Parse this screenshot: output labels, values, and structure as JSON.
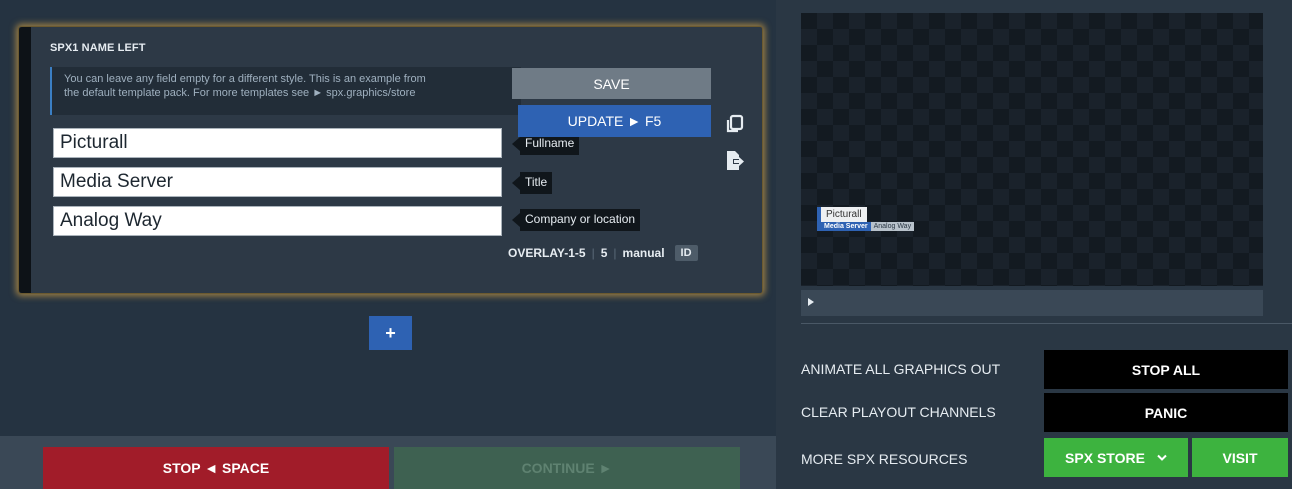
{
  "card": {
    "title": "SPX1 NAME LEFT",
    "info_line1": "You can leave any field empty for a different style. This is an example from",
    "info_line2": "the default template pack. For more templates see ► spx.graphics/store",
    "fields": [
      {
        "value": "Picturall",
        "tooltip": "Fullname"
      },
      {
        "value": "Media Server",
        "tooltip": "Title"
      },
      {
        "value": "Analog Way",
        "tooltip": "Company or location"
      }
    ],
    "save_label": "SAVE",
    "update_label": "UPDATE ► F5",
    "meta": {
      "layer": "OVERLAY-1-5",
      "count": "5",
      "mode": "manual",
      "badge": "ID"
    }
  },
  "add_label": "+",
  "bottom": {
    "stop_label": "STOP ◄ SPACE",
    "continue_label": "CONTINUE ►"
  },
  "preview": {
    "name": "Picturall",
    "title": "Media Server",
    "company": "Analog Way"
  },
  "controls": {
    "animate_label": "ANIMATE ALL GRAPHICS OUT",
    "stop_all_label": "STOP ALL",
    "clear_label": "CLEAR PLAYOUT CHANNELS",
    "panic_label": "PANIC",
    "resources_label": "MORE SPX RESOURCES",
    "store_label": "SPX STORE",
    "visit_label": "VISIT"
  },
  "colors": {
    "accent": "#2e62b3",
    "stop": "#a11c29",
    "store": "#3db33f",
    "glow": "#e0aa48"
  },
  "icons": [
    "copy-icon",
    "export-icon",
    "play-icon",
    "chevron-down-icon"
  ]
}
